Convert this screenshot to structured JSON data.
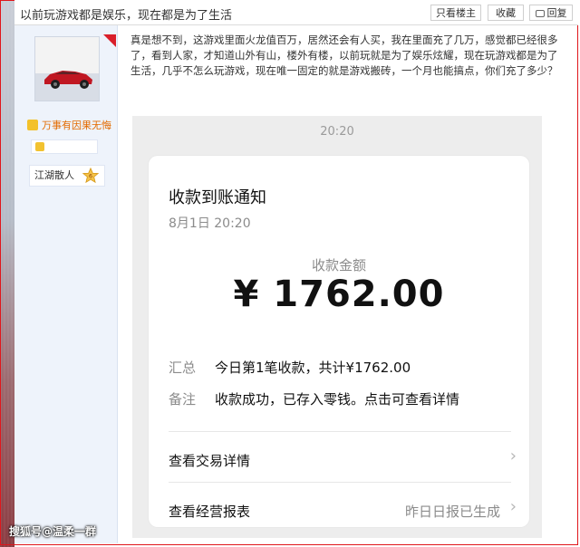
{
  "forum": {
    "title": "以前玩游戏都是娱乐，现在都是为了生活",
    "buttons": {
      "only_op": "只看楼主",
      "favorite": "收藏",
      "reply": "回复"
    },
    "user": {
      "tag": "万事有因果无悔",
      "rank": "江湖散人",
      "level": "6"
    },
    "post_text": "真是想不到，这游戏里面火龙值百万，居然还会有人买，我在里面充了几万，感觉都已经很多了，看到人家，才知道山外有山，楼外有楼，以前玩就是为了娱乐炫耀，现在玩游戏都是为了生活，几乎不怎么玩游戏，现在唯一固定的就是游戏搬砖，一个月也能搞点，你们充了多少？"
  },
  "screenshot": {
    "time": "20:20",
    "card": {
      "title": "收款到账通知",
      "date": "8月1日 20:20",
      "amount_label": "收款金额",
      "amount": "¥ 1762.00",
      "summary_label": "汇总",
      "summary_value": "今日第1笔收款，共计¥1762.00",
      "note_label": "备注",
      "note_value": "收款成功，已存入零钱。点击可查看详情",
      "link_1": "查看交易详情",
      "link_2": "查看经营报表",
      "link_2_right": "昨日日报已生成"
    }
  },
  "watermark": "搜狐号@温柔一群"
}
